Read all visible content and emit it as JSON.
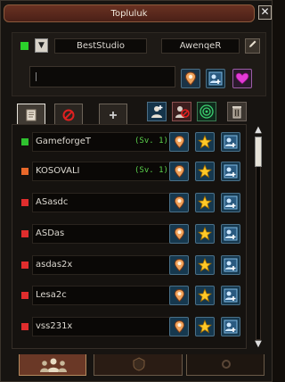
{
  "window": {
    "title": "Topluluk",
    "close_glyph": "✕"
  },
  "header": {
    "status_color": "#2bd12b",
    "dropdown_glyph": "▼",
    "field_left": "BestStudio",
    "field_right": "AwenqeR",
    "edit_icon": "pencil-icon",
    "message_value": "",
    "buttons": [
      "map-pin-icon",
      "add-friend-icon",
      "heart-icon"
    ]
  },
  "tabs": [
    {
      "icon": "document-icon",
      "active": true
    },
    {
      "icon": "blocked-icon",
      "active": false
    },
    {
      "icon": "plus-icon",
      "active": false
    }
  ],
  "toolbar": [
    "group-icon",
    "blocked-user-icon",
    "radar-icon",
    "trash-icon"
  ],
  "members": [
    {
      "name": "GameforgeT",
      "level": "(Sv. 1)",
      "status_color": "#2fc22f"
    },
    {
      "name": "KOSOVALI",
      "level": "(Sv. 1)",
      "status_color": "#e9682a"
    },
    {
      "name": "ASasdc",
      "level": "",
      "status_color": "#e02d2d"
    },
    {
      "name": "ASDas",
      "level": "",
      "status_color": "#e02d2d"
    },
    {
      "name": "asdas2x",
      "level": "",
      "status_color": "#e02d2d"
    },
    {
      "name": "Lesa2c",
      "level": "",
      "status_color": "#e02d2d"
    },
    {
      "name": "vss231x",
      "level": "",
      "status_color": "#e02d2d"
    }
  ],
  "row_buttons": [
    "map-pin-icon",
    "star-icon",
    "add-friend-icon"
  ],
  "scrollbar": {
    "up": "▲",
    "down": "▼",
    "position": 0
  },
  "bottom_tabs": [
    "friends-group-icon",
    "emblem-icon",
    "gear-icon"
  ]
}
